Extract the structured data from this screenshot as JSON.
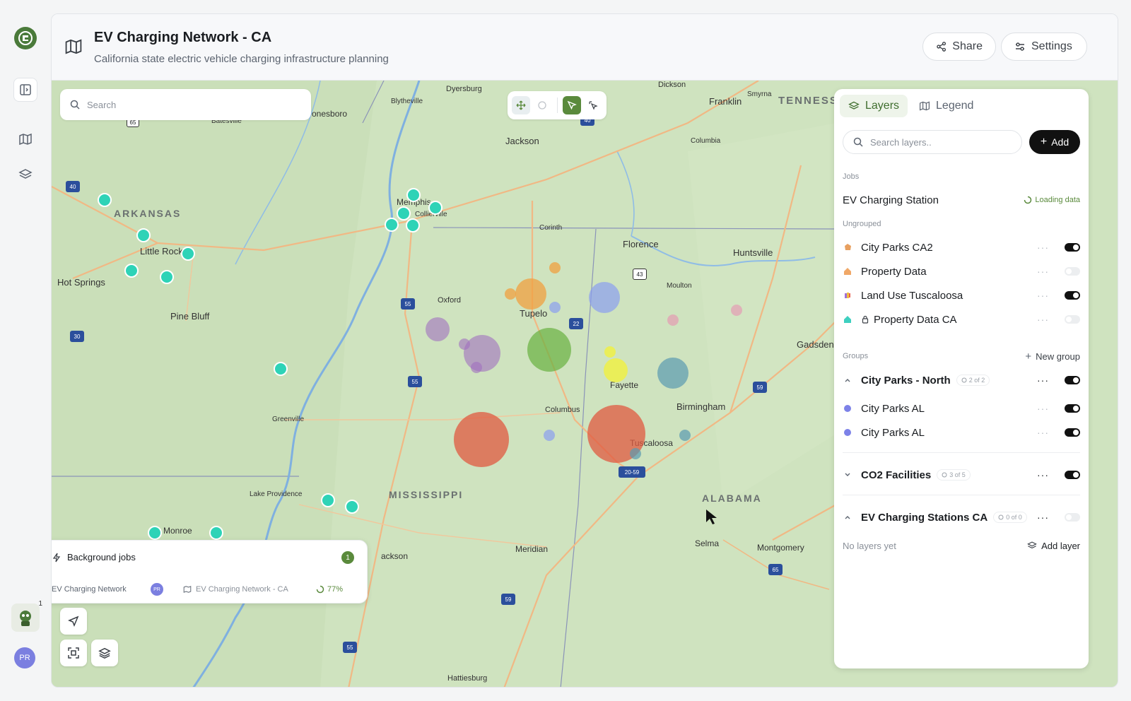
{
  "app": {
    "title": "EV Charging Network - CA",
    "subtitle": "California state electric vehicle charging infrastructure planning",
    "share_label": "Share",
    "settings_label": "Settings"
  },
  "rail": {
    "user_initials": "PR",
    "notification_count": "1"
  },
  "map": {
    "search_placeholder": "Search",
    "labels": {
      "tennessee": "TENNESS",
      "arkansas": "ARKANSAS",
      "mississippi": "MISSISSIPPI",
      "alabama": "ALABAMA",
      "dyersburg": "Dyersburg",
      "blytheville": "Blytheville",
      "jonesboro": "onesboro",
      "batesville": "Batesville",
      "dickson": "Dickson",
      "franklin": "Franklin",
      "smyrna": "Smyrna",
      "jackson_tn": "Jackson",
      "columbia": "Columbia",
      "memphis": "Memphis",
      "collierville": "Collierville",
      "corinth": "Corinth",
      "florence": "Florence",
      "huntsville": "Huntsville",
      "little_rock": "Little Rock",
      "hot_springs": "Hot Springs",
      "pine_bluff": "Pine Bluff",
      "oxford": "Oxford",
      "tupelo": "Tupelo",
      "moulton": "Moulton",
      "gadsden": "Gadsden",
      "fayette": "Fayette",
      "birmingham": "Birmingham",
      "columbus": "Columbus",
      "tuscaloosa": "Tuscaloosa",
      "greenville": "Greenville",
      "lake_providence": "Lake Providence",
      "monroe": "Monroe",
      "jackson_ms": "ackson",
      "meridian": "Meridian",
      "selma": "Selma",
      "montgomery": "Montgomery",
      "hattiesburg": "Hattiesburg"
    },
    "shields": [
      "65",
      "40",
      "40",
      "55",
      "22",
      "43",
      "55",
      "30",
      "59",
      "20-59",
      "59",
      "65",
      "55"
    ]
  },
  "layers_panel": {
    "tab_layers": "Layers",
    "tab_legend": "Legend",
    "search_placeholder": "Search layers..",
    "add_label": "Add",
    "jobs_section": "Jobs",
    "job_item": "EV Charging Station",
    "job_status": "Loading data",
    "ungrouped_section": "Ungrouped",
    "ungrouped": [
      {
        "name": "City Parks CA2",
        "on": true,
        "color": "#e8a060"
      },
      {
        "name": "Property Data",
        "on": false,
        "color": "#f0a868"
      },
      {
        "name": "Land Use Tuscaloosa",
        "on": true,
        "color": "#a070d8"
      },
      {
        "name": "Property Data CA",
        "on": false,
        "color": "#3ed0c0"
      }
    ],
    "groups_section": "Groups",
    "new_group_label": "New group",
    "groups": [
      {
        "name": "City Parks - North",
        "count": "2 of 2",
        "items": [
          "City Parks AL",
          "City Parks AL"
        ]
      },
      {
        "name": "CO2 Facilities",
        "count": "3 of 5"
      },
      {
        "name": "EV Charging Stations CA",
        "count": "0 of 0",
        "empty_text": "No layers yet",
        "add_layer_label": "Add layer"
      }
    ]
  },
  "jobs": {
    "title": "Background jobs",
    "count": "1",
    "job_name": "EV Charging Network",
    "job_avatar": "PR",
    "project_name": "EV Charging Network - CA",
    "progress_text": "77%"
  },
  "colors": {
    "accent": "#4a7a3a",
    "teal_marker": "#2ed3b7"
  }
}
